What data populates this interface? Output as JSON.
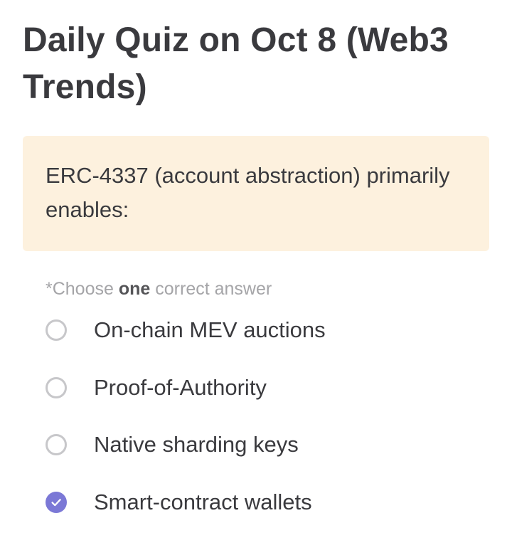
{
  "quiz": {
    "title": "Daily Quiz on Oct 8 (Web3 Trends)",
    "question": "ERC-4337 (account abstraction) primarily enables:",
    "instruction": {
      "prefix": "*Choose ",
      "emphasis": "one",
      "suffix": " correct answer"
    },
    "options": [
      {
        "label": "On-chain MEV auctions",
        "selected": false
      },
      {
        "label": "Proof-of-Authority",
        "selected": false
      },
      {
        "label": "Native sharding keys",
        "selected": false
      },
      {
        "label": "Smart-contract wallets",
        "selected": true
      }
    ]
  },
  "colors": {
    "question_background": "#fdf1de",
    "selected_radio": "#7b78d6",
    "unselected_radio_border": "#c7c7ca",
    "title_text": "#3a3a3e",
    "instruction_text": "#a5a5a8"
  },
  "icons": {
    "selected": "check-icon"
  }
}
